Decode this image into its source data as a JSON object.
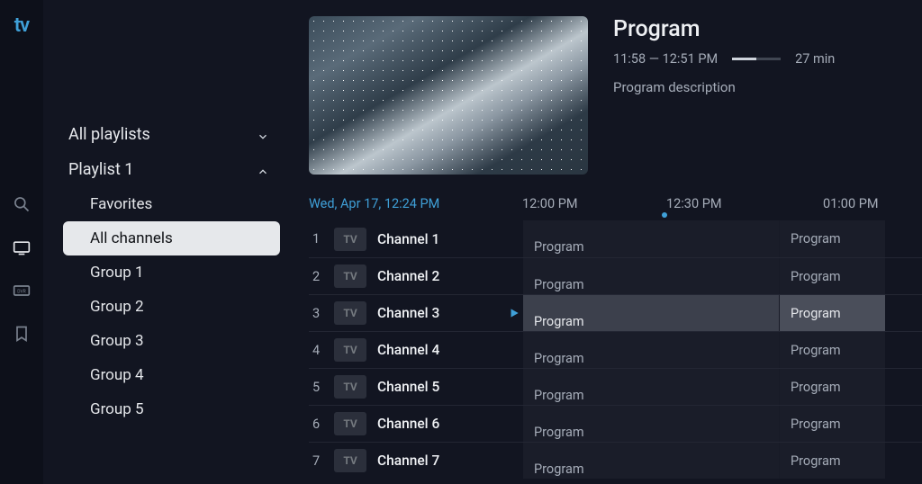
{
  "logo": "tv",
  "sidebar": {
    "all_playlists": "All playlists",
    "playlist": "Playlist 1",
    "items": [
      {
        "label": "Favorites"
      },
      {
        "label": "All channels"
      },
      {
        "label": "Group 1"
      },
      {
        "label": "Group 2"
      },
      {
        "label": "Group 3"
      },
      {
        "label": "Group 4"
      },
      {
        "label": "Group 5"
      }
    ]
  },
  "hero": {
    "title": "Program",
    "timerange": "11:58 — 12:51 PM",
    "remaining": "27 min",
    "description": "Program description"
  },
  "guide": {
    "now": "Wed, Apr 17, 12:24 PM",
    "slots": [
      "12:00 PM",
      "12:30 PM",
      "01:00 PM"
    ],
    "channel_logo": "TV",
    "program_label": "Program",
    "channels": [
      {
        "num": "1",
        "name": "Channel 1"
      },
      {
        "num": "2",
        "name": "Channel 2"
      },
      {
        "num": "3",
        "name": "Channel 3"
      },
      {
        "num": "4",
        "name": "Channel 4"
      },
      {
        "num": "5",
        "name": "Channel 5"
      },
      {
        "num": "6",
        "name": "Channel 6"
      },
      {
        "num": "7",
        "name": "Channel 7"
      }
    ],
    "selected_index": 2
  }
}
